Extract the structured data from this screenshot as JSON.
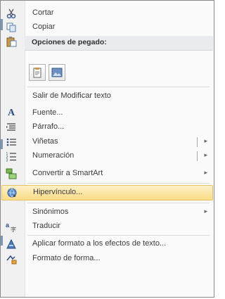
{
  "menu": {
    "items": [
      {
        "label": "Cortar",
        "icon": "scissors-icon"
      },
      {
        "label": "Copiar",
        "icon": "copy-icon"
      },
      {
        "label": "Opciones de pegado:",
        "icon": "paste-icon"
      },
      {
        "label": "Salir de Modificar texto"
      },
      {
        "label": "Fuente...",
        "icon": "font-icon"
      },
      {
        "label": "Párrafo...",
        "icon": "paragraph-icon"
      },
      {
        "label": "Viñetas",
        "icon": "bullets-icon",
        "submenu": true
      },
      {
        "label": "Numeración",
        "icon": "numbering-icon",
        "submenu": true
      },
      {
        "label": "Convertir a SmartArt",
        "icon": "smartart-icon",
        "submenu": true
      },
      {
        "label": "Hipervínculo...",
        "icon": "hyperlink-icon"
      },
      {
        "label": "Sinónimos",
        "submenu": true
      },
      {
        "label": "Traducir",
        "icon": "translate-icon"
      },
      {
        "label": "Aplicar formato a los efectos de texto...",
        "icon": "text-effects-icon"
      },
      {
        "label": "Formato de forma...",
        "icon": "shape-format-icon"
      }
    ],
    "paste_options": [
      {
        "name": "paste-keep-source-button",
        "icon": "clipboard-icon"
      },
      {
        "name": "paste-picture-button",
        "icon": "picture-icon"
      }
    ]
  },
  "colors": {
    "highlight": "#fbdc86",
    "header_bg": "#e9ebee"
  }
}
